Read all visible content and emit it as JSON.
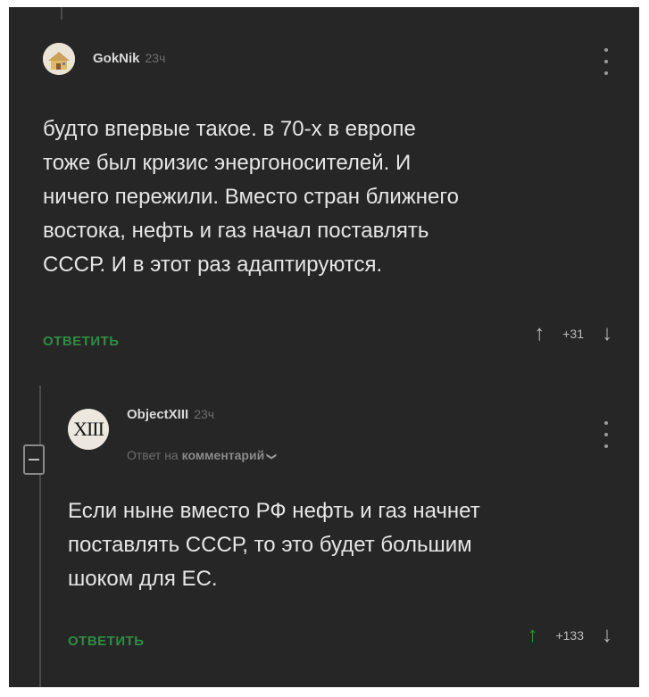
{
  "comments": [
    {
      "author": "GokNik",
      "time": "23ч",
      "text": "будто впервые такое. в 70-х в европе\nтоже был кризис энергоносителей. И\nничего пережили. Вместо стран ближнего\nвостока, нефть и газ начал поставлять\nСССР.  И в этот раз адаптируются.",
      "reply_label": "ОТВЕТИТЬ",
      "score": "+31",
      "avatar_icon": "house-icon"
    },
    {
      "author": "ObjectXIII",
      "time": "23ч",
      "avatar_text": "XIII",
      "reply_to_prefix": "Ответ на",
      "reply_to_target": "комментарий",
      "text": "Если ныне вместо РФ нефть и газ начнет\nпоставлять СССР, то это будет большим\nшоком для ЕС.",
      "reply_label": "ОТВЕТИТЬ",
      "score": "+133",
      "upvoted": true
    }
  ],
  "colors": {
    "background": "#262626",
    "text": "#e6e6e6",
    "accent": "#2f8d42",
    "muted": "#6e6e6e"
  },
  "icons": {
    "more": "more-vertical-icon",
    "upvote": "arrow-up-icon",
    "downvote": "arrow-down-icon",
    "collapse": "collapse-minus-icon",
    "chevron": "chevron-down-icon"
  }
}
